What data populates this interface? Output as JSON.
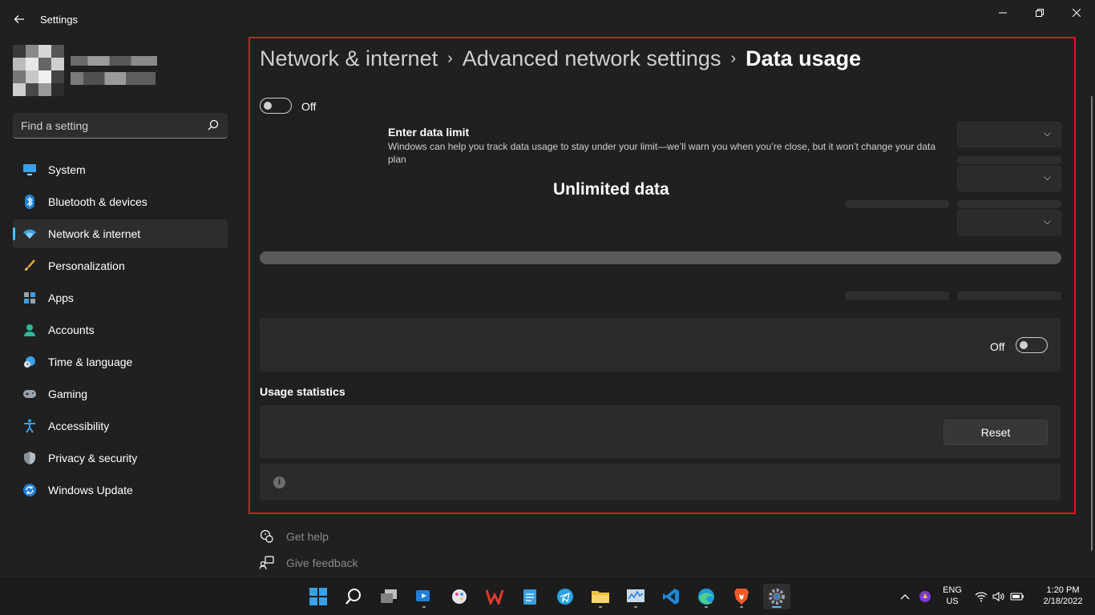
{
  "window": {
    "title": "Settings",
    "back_icon": "back-arrow-icon",
    "minimize_icon": "minimize-icon",
    "maximize_icon": "restore-icon",
    "close_icon": "close-icon"
  },
  "search": {
    "placeholder": "Find a setting",
    "icon": "search-icon"
  },
  "sidebar": {
    "items": [
      {
        "label": "System",
        "icon": "monitor-icon"
      },
      {
        "label": "Bluetooth & devices",
        "icon": "bluetooth-icon"
      },
      {
        "label": "Network & internet",
        "icon": "wifi-icon",
        "selected": true
      },
      {
        "label": "Personalization",
        "icon": "brush-icon"
      },
      {
        "label": "Apps",
        "icon": "apps-icon"
      },
      {
        "label": "Accounts",
        "icon": "person-icon"
      },
      {
        "label": "Time & language",
        "icon": "clock-globe-icon"
      },
      {
        "label": "Gaming",
        "icon": "controller-icon"
      },
      {
        "label": "Accessibility",
        "icon": "accessibility-icon"
      },
      {
        "label": "Privacy & security",
        "icon": "shield-icon"
      },
      {
        "label": "Windows Update",
        "icon": "update-icon"
      }
    ]
  },
  "breadcrumb": {
    "part1": "Network & internet",
    "part2": "Advanced network settings",
    "current": "Data usage",
    "separator": "›"
  },
  "main": {
    "limit_toggle_state": "Off",
    "limit_title": "Enter data limit",
    "limit_description": "Windows can help you track data usage to stay under your limit—we’ll warn you when you’re close, but it won’t change your data plan",
    "unlimited_label": "Unlimited data",
    "metered_toggle_state": "Off",
    "usage_section_title": "Usage statistics",
    "reset_label": "Reset",
    "info_icon_glyph": "i"
  },
  "links": {
    "help": "Get help",
    "feedback": "Give feedback"
  },
  "tray": {
    "language_line1": "ENG",
    "language_line2": "US",
    "time": "1:20 PM",
    "date": "2/18/2022"
  },
  "colors": {
    "accent": "#4cc2ff",
    "highlight_border": "#e81123",
    "background": "#202020"
  }
}
